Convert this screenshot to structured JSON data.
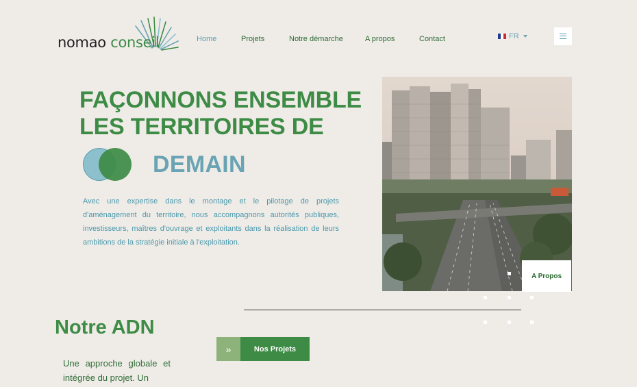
{
  "brand": {
    "logo_word1": "nomao",
    "logo_word2": "conseil"
  },
  "nav": {
    "items": [
      "Home",
      "Projets",
      "Notre démarche",
      "A propos",
      "Contact"
    ],
    "active": "Home"
  },
  "language": {
    "selected": "FR"
  },
  "hero": {
    "title_line1": "FAÇONNONS ENSEMBLE",
    "title_line2": "LES TERRITOIRES DE",
    "title_line3": "DEMAIN",
    "text": "Avec une expertise dans le montage et le pilotage de projets d'aménagement du territoire, nous accompagnons autorités publiques, investisseurs, maîtres d'ouvrage et exploitants dans la réalisation de leurs ambitions de la stratégie initiale à l'exploitation.",
    "image_card_label": "A Propos"
  },
  "adn": {
    "title": "Notre ADN",
    "text": "Une approche globale et intégrée du projet. Un",
    "button_label": "Nos Projets"
  },
  "colors": {
    "primary_green": "#3d8b45",
    "accent_blue": "#6aa3b3",
    "background": "#efece8"
  }
}
